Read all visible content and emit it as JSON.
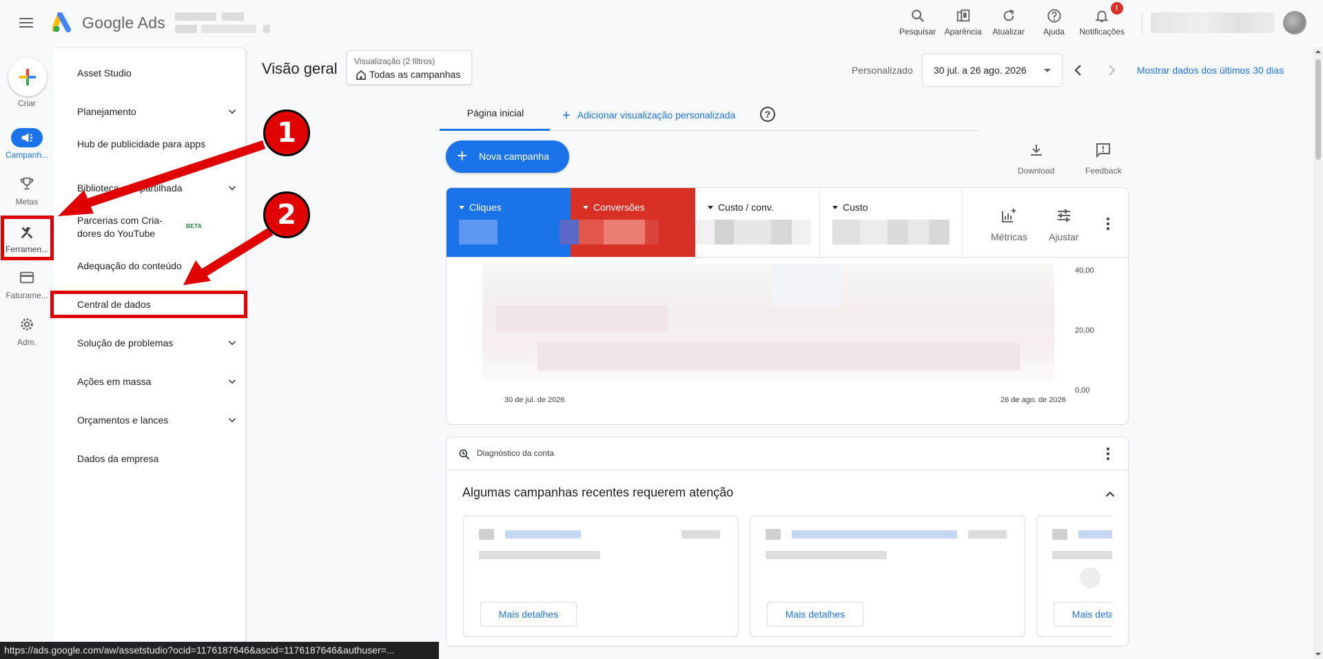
{
  "brand": "Google Ads",
  "top_actions": [
    {
      "label": "Pesquisar",
      "icon": "search-icon"
    },
    {
      "label": "Aparência",
      "icon": "appearance-icon"
    },
    {
      "label": "Atualizar",
      "icon": "refresh-icon"
    },
    {
      "label": "Ajuda",
      "icon": "help-icon"
    },
    {
      "label": "Notificações",
      "icon": "bell-icon",
      "badge": "!"
    }
  ],
  "rail": {
    "create_label": "Criar",
    "items": [
      {
        "label": "Campanh...",
        "icon": "campaigns-icon",
        "active": true
      },
      {
        "label": "Metas",
        "icon": "trophy-icon"
      },
      {
        "label": "Ferramen...",
        "icon": "tools-icon"
      },
      {
        "label": "Faturame...",
        "icon": "billing-icon"
      },
      {
        "label": "Adm.",
        "icon": "gear-icon"
      }
    ]
  },
  "tools_menu": [
    {
      "label": "Asset Studio",
      "expandable": false
    },
    {
      "label": "Planejamento",
      "expandable": true
    },
    {
      "label": "Hub de publicidade para apps",
      "expandable": false
    },
    {
      "label": "Biblioteca compartilhada",
      "expandable": true
    },
    {
      "label": "Parcerias com Cria-dores do YouTube",
      "expandable": false,
      "badge": "BETA"
    },
    {
      "label": "Adequação do conteúdo",
      "expandable": false
    },
    {
      "label": "Central de dados",
      "expandable": false
    },
    {
      "label": "Solução de problemas",
      "expandable": true
    },
    {
      "label": "Ações em massa",
      "expandable": true
    },
    {
      "label": "Orçamentos e lances",
      "expandable": true
    },
    {
      "label": "Dados da empresa",
      "expandable": false
    }
  ],
  "annotations": {
    "step1": "1",
    "step2": "2"
  },
  "header": {
    "title": "Visão geral",
    "filter_sub": "Visualização (2 filtros)",
    "filter_main": "Todas as campanhas",
    "date_label": "Personalizado",
    "date_range": "30 jul. a 26 ago. 2026",
    "last30": "Mostrar dados dos últimos 30 dias"
  },
  "tabs": {
    "home": "Página inicial",
    "add": "Adicionar visualização personalizada"
  },
  "toolbar": {
    "new_campaign": "Nova campanha",
    "download": "Download",
    "feedback": "Feedback"
  },
  "metrics": [
    {
      "name": "Cliques",
      "color": "#1a73e8"
    },
    {
      "name": "Conversões",
      "color": "#d93025"
    },
    {
      "name": "Custo / conv.",
      "color": "#ffffff"
    },
    {
      "name": "Custo",
      "color": "#ffffff"
    }
  ],
  "card_tools": {
    "metrics": "Métricas",
    "adjust": "Ajustar"
  },
  "chart_data": {
    "type": "area",
    "yticks": [
      "40,00",
      "20,00",
      "0,00"
    ],
    "xticks": [
      "30 de jul. de 2026",
      "26 de ago. de 2026"
    ]
  },
  "diagnostics": {
    "title": "Diagnóstico da conta",
    "heading": "Algumas campanhas recentes requerem atenção",
    "details_label": "Mais detalhes"
  },
  "status_url": "https://ads.google.com/aw/assetstudio?ocid=1176187646&ascid=1176187646&authuser=..."
}
